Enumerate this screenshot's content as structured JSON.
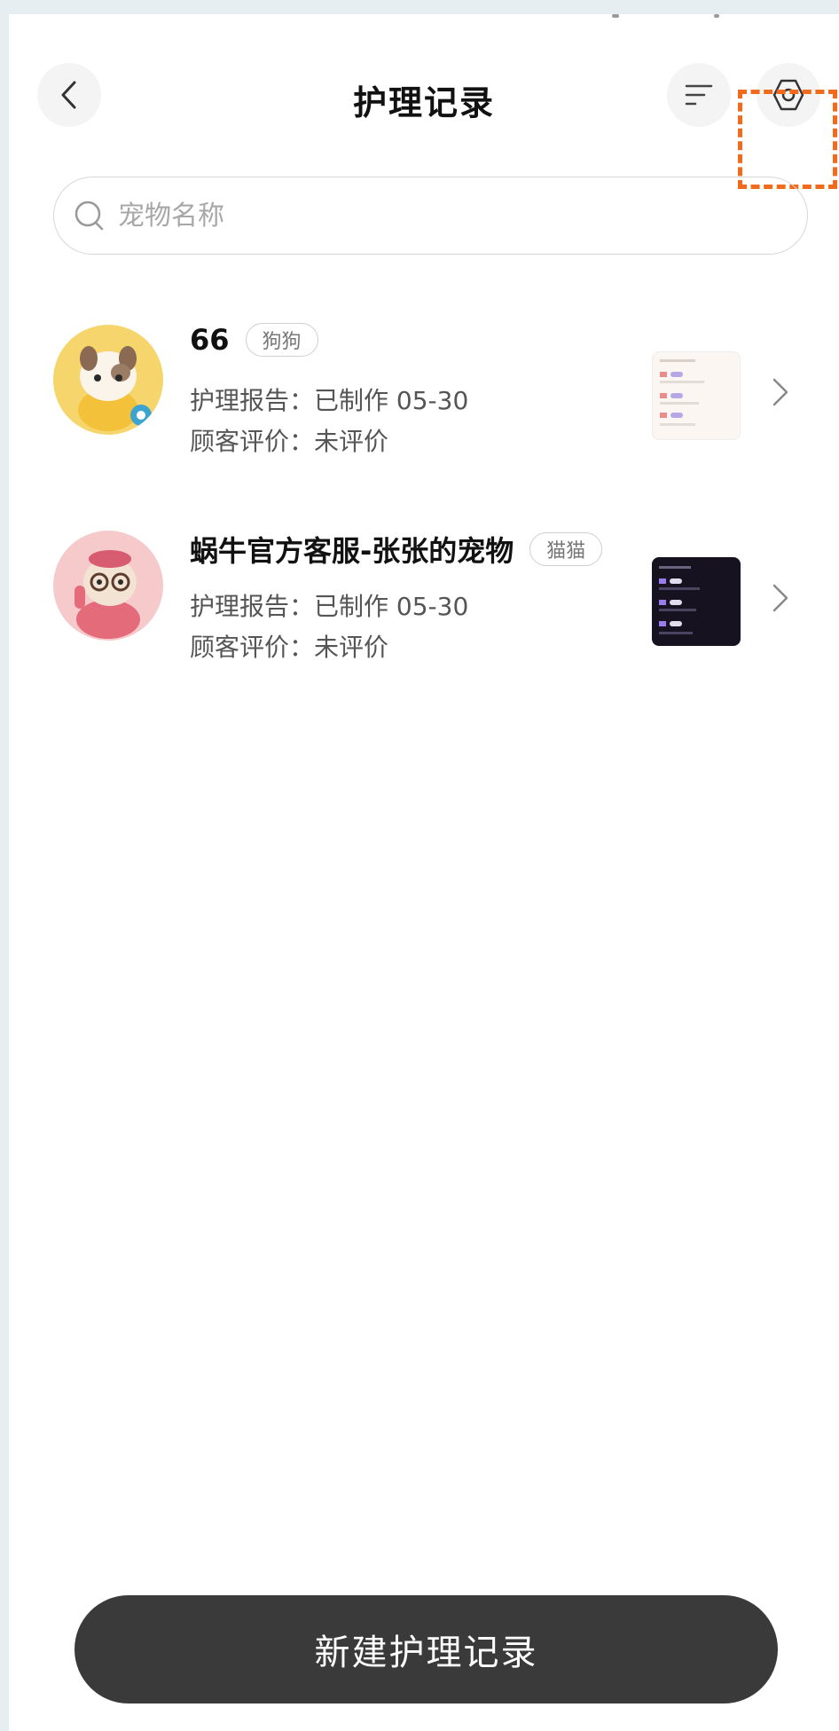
{
  "header": {
    "title": "护理记录"
  },
  "search": {
    "placeholder": "宠物名称"
  },
  "records": [
    {
      "name": "66",
      "tag": "狗狗",
      "report": "护理报告：已制作 05-30",
      "review": "顾客评价：未评价"
    },
    {
      "name": "蜗牛官方客服-张张的宠物",
      "tag": "猫猫",
      "report": "护理报告：已制作 05-30",
      "review": "顾客评价：未评价"
    }
  ],
  "footer": {
    "new_button_label": "新建护理记录"
  },
  "colors": {
    "highlight": "#f26b1d",
    "button_bg": "#3a3a3a"
  },
  "icons": [
    "back-icon",
    "filter-icon",
    "settings-icon",
    "search-icon",
    "chevron-right-icon"
  ]
}
